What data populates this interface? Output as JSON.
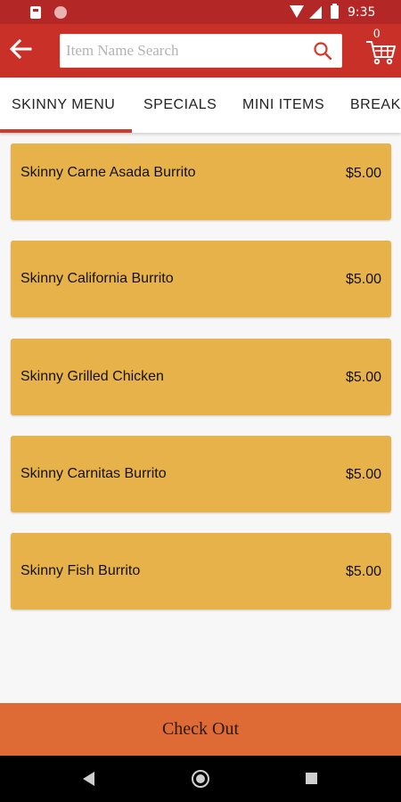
{
  "status_bar": {
    "time": "9:35"
  },
  "search": {
    "placeholder": "Item Name Search",
    "value": ""
  },
  "cart": {
    "count": "0"
  },
  "tabs": [
    {
      "label": "SKINNY MENU",
      "selected": true
    },
    {
      "label": "SPECIALS",
      "selected": false
    },
    {
      "label": "MINI ITEMS",
      "selected": false
    },
    {
      "label": "BREAKFAST",
      "selected": false
    }
  ],
  "items": [
    {
      "name": "Skinny Carne Asada Burrito",
      "price": "$5.00"
    },
    {
      "name": "Skinny California Burrito",
      "price": "$5.00"
    },
    {
      "name": "Skinny Grilled Chicken",
      "price": "$5.00"
    },
    {
      "name": "Skinny Carnitas Burrito",
      "price": "$5.00"
    },
    {
      "name": "Skinny Fish Burrito",
      "price": "$5.00"
    }
  ],
  "checkout_label": "Check Out",
  "colors": {
    "status_bar": "#b32826",
    "app_bar": "#c93028",
    "card": "#e8b24a",
    "checkout": "#de6a35",
    "tab_indicator": "#d43a2b"
  }
}
